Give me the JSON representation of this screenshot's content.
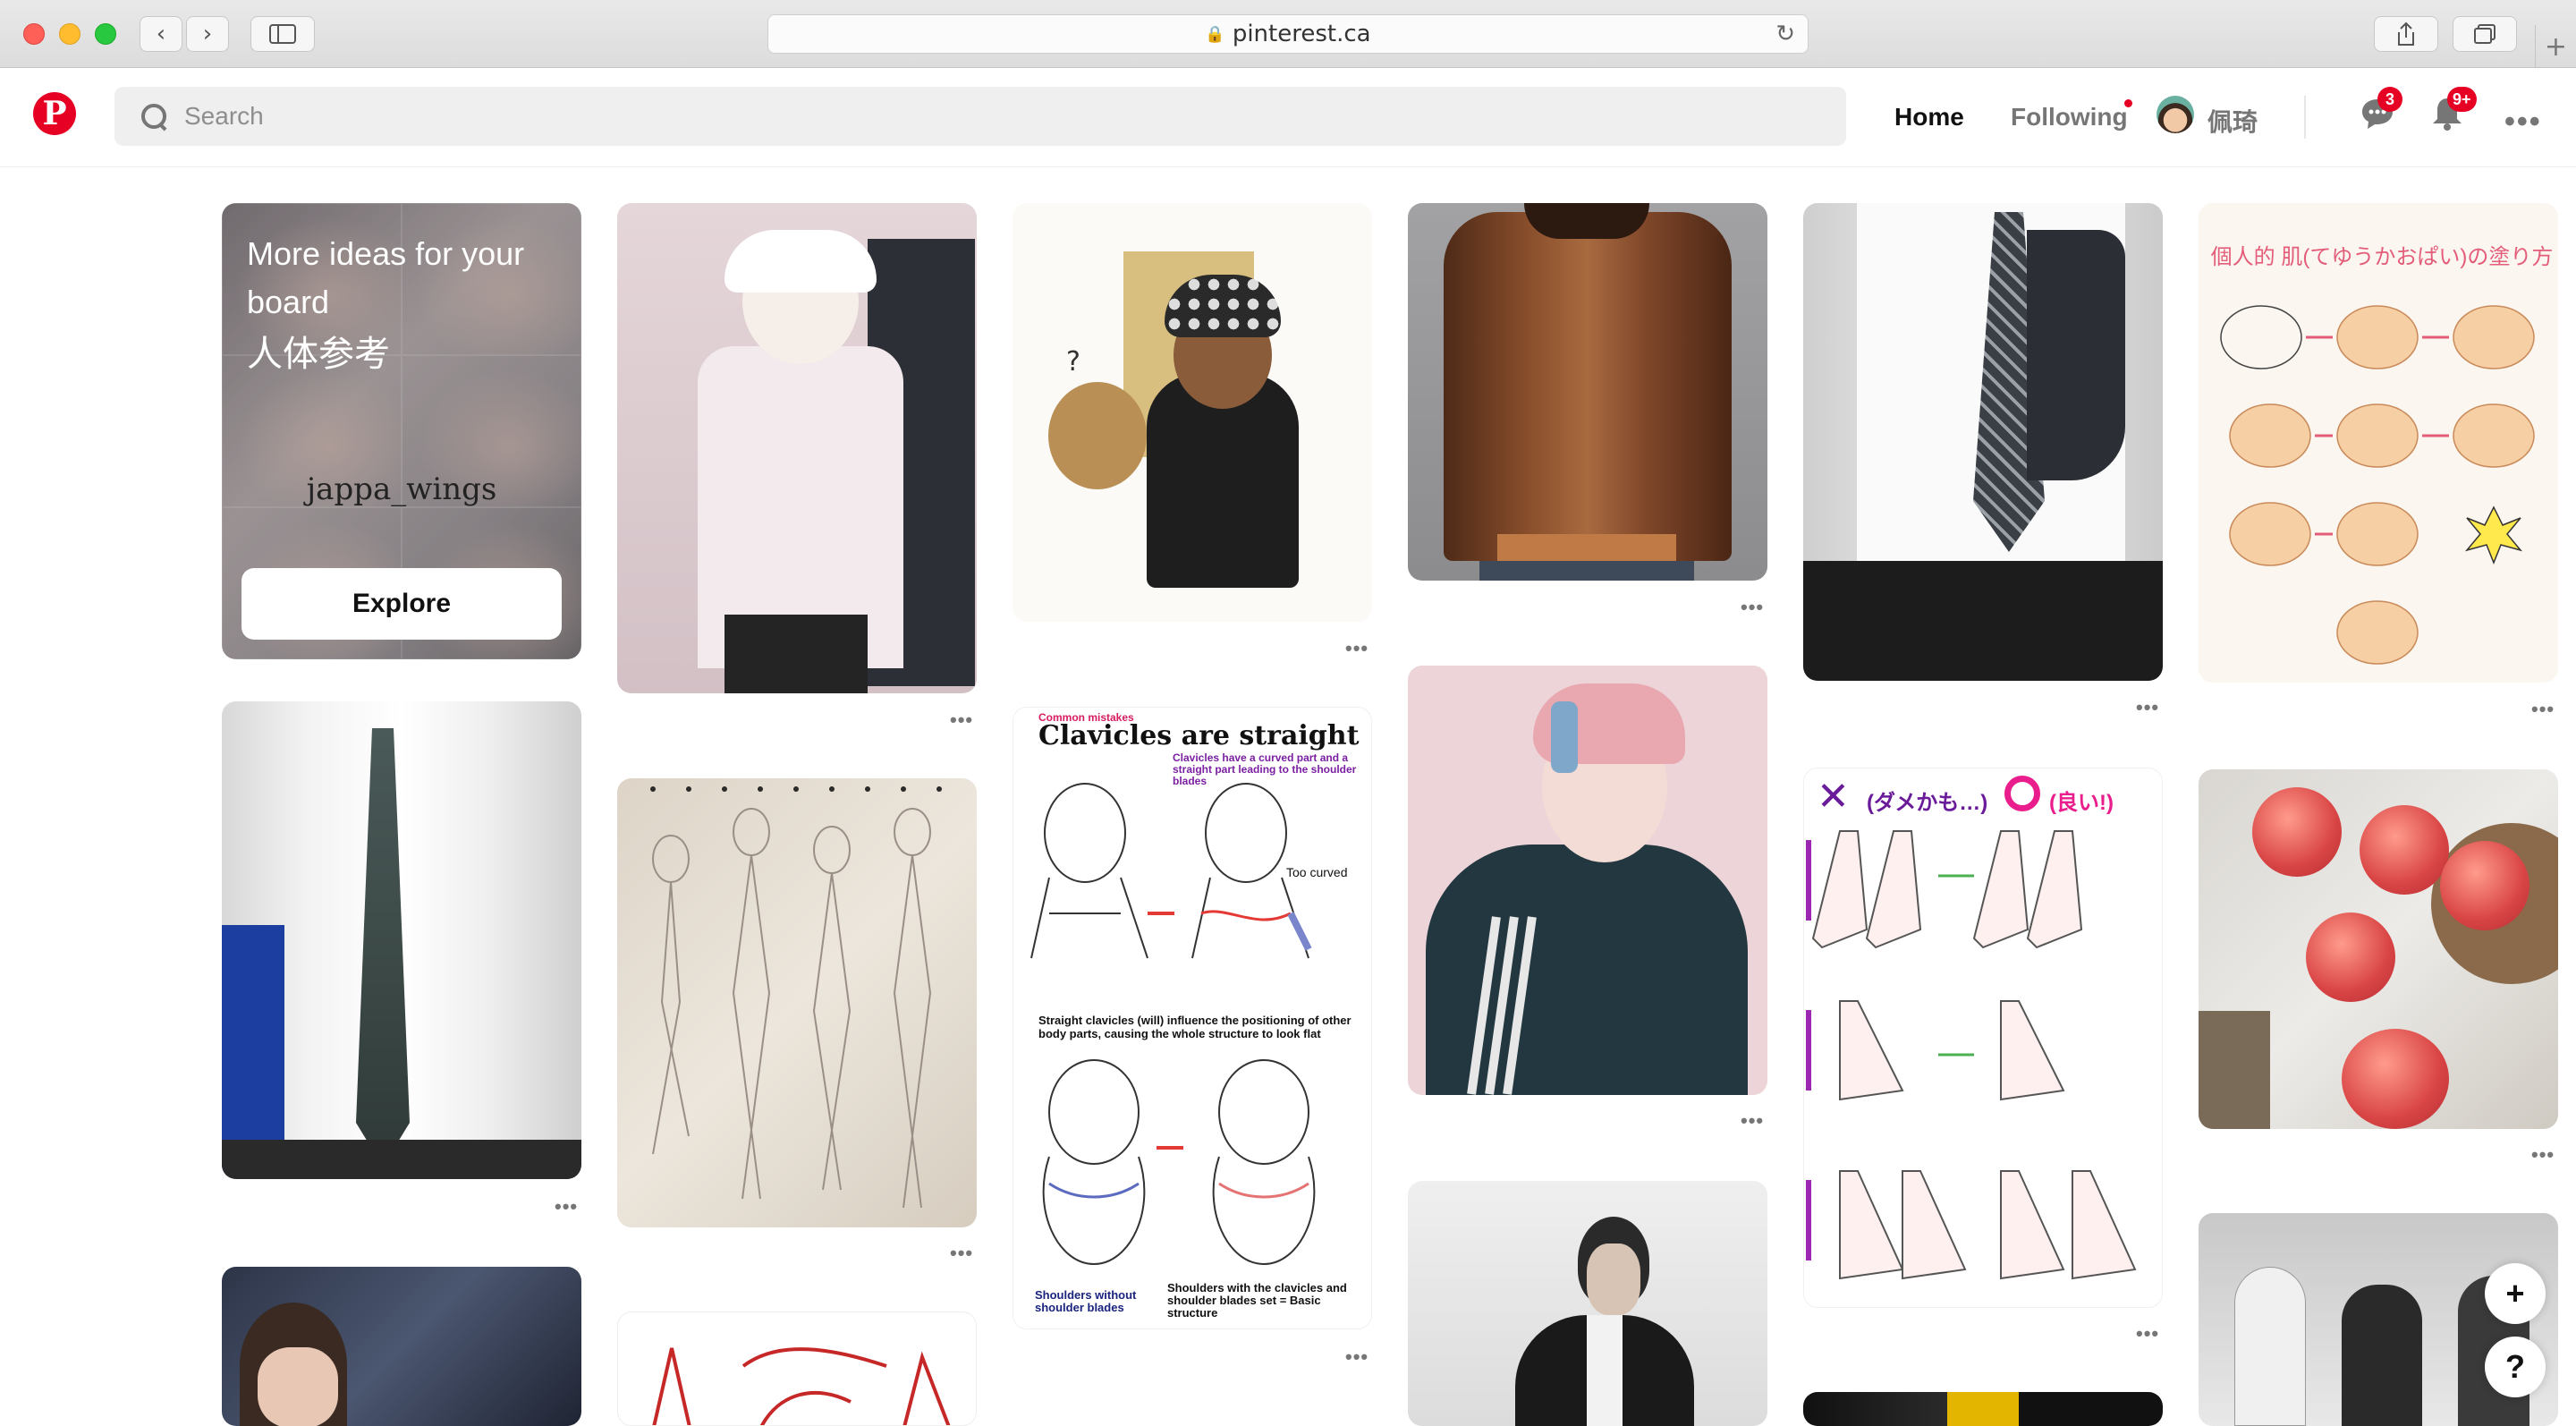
{
  "browser": {
    "url": "pinterest.ca",
    "back_icon": "chevron-left-icon",
    "forward_icon": "chevron-right-icon",
    "sidebar_icon": "sidebar-icon",
    "share_icon": "share-icon",
    "tabs_icon": "tabs-icon",
    "new_tab": "+"
  },
  "header": {
    "search_placeholder": "Search",
    "nav_home": "Home",
    "nav_following": "Following",
    "username": "佩琦",
    "messages_badge": "3",
    "notifications_badge": "9+",
    "more_label": "•••",
    "brand_color": "#e60023"
  },
  "board_card": {
    "title": "More ideas for your board",
    "board_name": "人体参考",
    "watermark": "jappa_wings",
    "explore_label": "Explore"
  },
  "pins": {
    "more_label": "•••",
    "clavicle_chart": {
      "header": "Common mistakes",
      "title": "Clavicles are straight",
      "note": "Clavicles have a curved part and a straight part leading to the shoulder blades",
      "too_curved": "Too curved",
      "caption": "Straight clavicles (will) influence the positioning of other body parts, causing the whole structure to look flat",
      "left_label": "Shoulders without shoulder blades",
      "right_label": "Shoulders with the clavicles and shoulder blades set = Basic structure"
    },
    "skin_chart_title": "個人的 肌(てゆうかおぱい)の塗り方",
    "shoes_chart": {
      "bad": "(ダメかも…)",
      "good": "(良い!)"
    }
  },
  "fab": {
    "plus": "+",
    "help": "?"
  }
}
